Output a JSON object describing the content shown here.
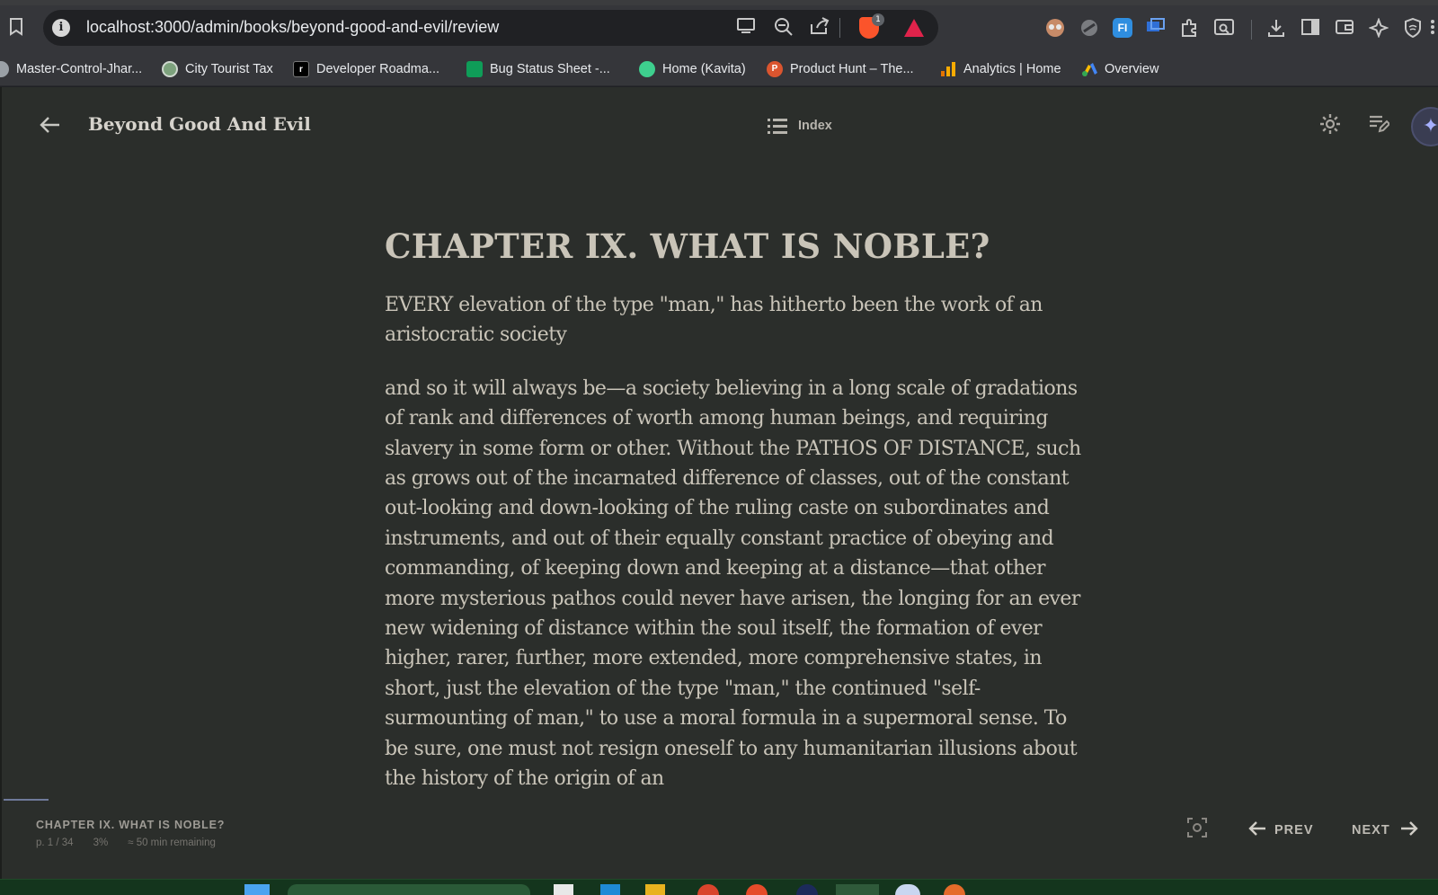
{
  "browser": {
    "url": "localhost:3000/admin/books/beyond-good-and-evil/review",
    "brave_badge": "1",
    "extension_badge": "FI"
  },
  "bookmarks": [
    {
      "label": "Master-Control-Jhar...",
      "icon_color": "#9aa0a6"
    },
    {
      "label": "City Tourist Tax",
      "icon_color": "#7da27d"
    },
    {
      "label": "Developer Roadma...",
      "icon_color": "#000000"
    },
    {
      "label": "Bug Status Sheet -...",
      "icon_color": "#0f9d58"
    },
    {
      "label": "Home (Kavita)",
      "icon_color": "#3ecf8e"
    },
    {
      "label": "Product Hunt – The...",
      "icon_color": "#da552f"
    },
    {
      "label": "Analytics | Home",
      "icon_color": "#f9ab00"
    },
    {
      "label": "Overview",
      "icon_color": "#4285f4"
    }
  ],
  "reader": {
    "book_title": "Beyond Good And Evil",
    "index_label": "Index",
    "chapter_title": "CHAPTER IX. WHAT IS NOBLE?",
    "paragraph1": [
      "EVERY elevation of the type \"man,\" has hitherto been the work of an",
      "aristocratic society"
    ],
    "paragraph2": [
      "and so it will always be—a society believing in a long scale of gradations",
      "of rank and differences of worth among human beings, and requiring",
      "slavery in some form or other. Without the PATHOS OF DISTANCE, such",
      "as grows out of the incarnated difference of classes, out of the constant",
      "out-looking and down-looking of the ruling caste on subordinates and",
      "instruments, and out of their equally constant practice of obeying and",
      "commanding, of keeping down and keeping at a distance—that other",
      "more mysterious pathos could never have arisen, the longing for an ever",
      "new widening of distance within the soul itself, the formation of ever",
      "higher, rarer, further, more extended, more comprehensive states, in",
      "short, just the elevation of the type \"man,\" the continued \"self-",
      "surmounting of man,\" to use a moral formula in a supermoral sense. To",
      "be sure, one must not resign oneself to any humanitarian illusions about",
      "the history of the origin of an"
    ]
  },
  "footer": {
    "chapter": "CHAPTER IX. WHAT IS NOBLE?",
    "page": "p. 1 / 34",
    "percent": "3%",
    "remaining": "≈ 50 min remaining",
    "prev_label": "PREV",
    "next_label": "NEXT"
  },
  "colors": {
    "reader_bg": "#2b2e2b",
    "text": "#c9c4b8",
    "browser_bg": "#35363a",
    "accent": "#a6b0ff"
  }
}
